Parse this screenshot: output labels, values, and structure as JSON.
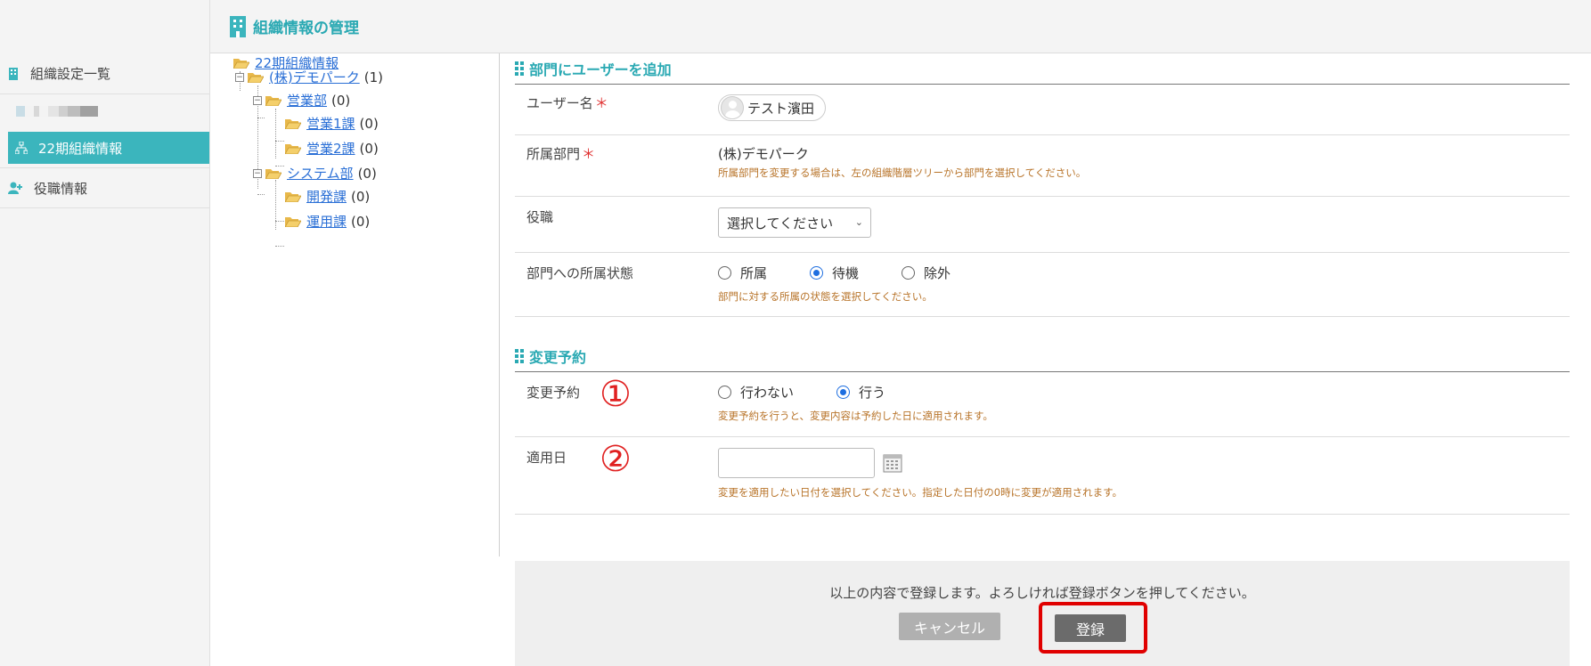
{
  "header": {
    "title": "組織情報の管理",
    "icon": "building-icon"
  },
  "sidebar": {
    "items": [
      {
        "label": "組織設定一覧",
        "icon": "building-icon"
      },
      {
        "label": "22期組織情報",
        "icon": "org-chart-icon",
        "active": true
      },
      {
        "label": "役職情報",
        "icon": "user-plus-icon"
      }
    ]
  },
  "tree": {
    "root": "22期組織情報",
    "company": {
      "label": "(株)デモパーク",
      "count": "(1)"
    },
    "dept1": {
      "label": "営業部",
      "count": "(0)"
    },
    "dept1_child1": {
      "label": "営業1課",
      "count": "(0)"
    },
    "dept1_child2": {
      "label": "営業2課",
      "count": "(0)"
    },
    "dept2": {
      "label": "システム部",
      "count": "(0)"
    },
    "dept2_child1": {
      "label": "開発課",
      "count": "(0)"
    },
    "dept2_child2": {
      "label": "運用課",
      "count": "(0)"
    }
  },
  "form": {
    "section1_title": "部門にユーザーを追加",
    "username_label": "ユーザー名",
    "username_value": "テスト濱田",
    "dept_label": "所属部門",
    "dept_value": "(株)デモパーク",
    "dept_hint": "所属部門を変更する場合は、左の組織階層ツリーから部門を選択してください。",
    "position_label": "役職",
    "position_value": "選択してください",
    "status_label": "部門への所属状態",
    "status_options": [
      "所属",
      "待機",
      "除外"
    ],
    "status_selected": "待機",
    "status_hint": "部門に対する所属の状態を選択してください。",
    "section2_title": "変更予約",
    "reserve_label": "変更予約",
    "reserve_marker": "①",
    "reserve_options": [
      "行わない",
      "行う"
    ],
    "reserve_selected": "行う",
    "reserve_hint": "変更予約を行うと、変更内容は予約した日に適用されます。",
    "apply_label": "適用日",
    "apply_marker": "②",
    "apply_value": "",
    "apply_hint": "変更を適用したい日付を選択してください。指定した日付の0時に変更が適用されます。",
    "required_mark": "＊"
  },
  "footer": {
    "message": "以上の内容で登録します。よろしければ登録ボタンを押してください。",
    "cancel_label": "キャンセル",
    "submit_label": "登録"
  },
  "colors": {
    "accent": "#3bb5bd",
    "highlight": "#e00000"
  }
}
